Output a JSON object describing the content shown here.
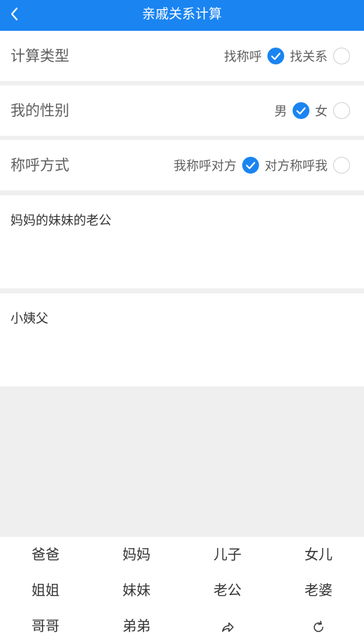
{
  "header": {
    "title": "亲戚关系计算",
    "back_icon": "chevron-left-icon"
  },
  "rows": [
    {
      "label": "计算类型",
      "options": [
        {
          "text": "找称呼",
          "checked": true
        },
        {
          "text": "找关系",
          "checked": false
        }
      ]
    },
    {
      "label": "我的性别",
      "options": [
        {
          "text": "男",
          "checked": true
        },
        {
          "text": "女",
          "checked": false
        }
      ]
    },
    {
      "label": "称呼方式",
      "options": [
        {
          "text": "我称呼对方",
          "checked": true
        },
        {
          "text": "对方称呼我",
          "checked": false
        }
      ]
    }
  ],
  "input_text": "妈妈的妹妹的老公",
  "result_text": "小姨父",
  "keypad": {
    "keys": [
      "爸爸",
      "妈妈",
      "儿子",
      "女儿",
      "姐姐",
      "妹妹",
      "老公",
      "老婆",
      "哥哥",
      "弟弟"
    ],
    "icons": [
      "share-arrow-icon",
      "refresh-icon"
    ]
  },
  "colors": {
    "accent": "#1a84f1"
  }
}
